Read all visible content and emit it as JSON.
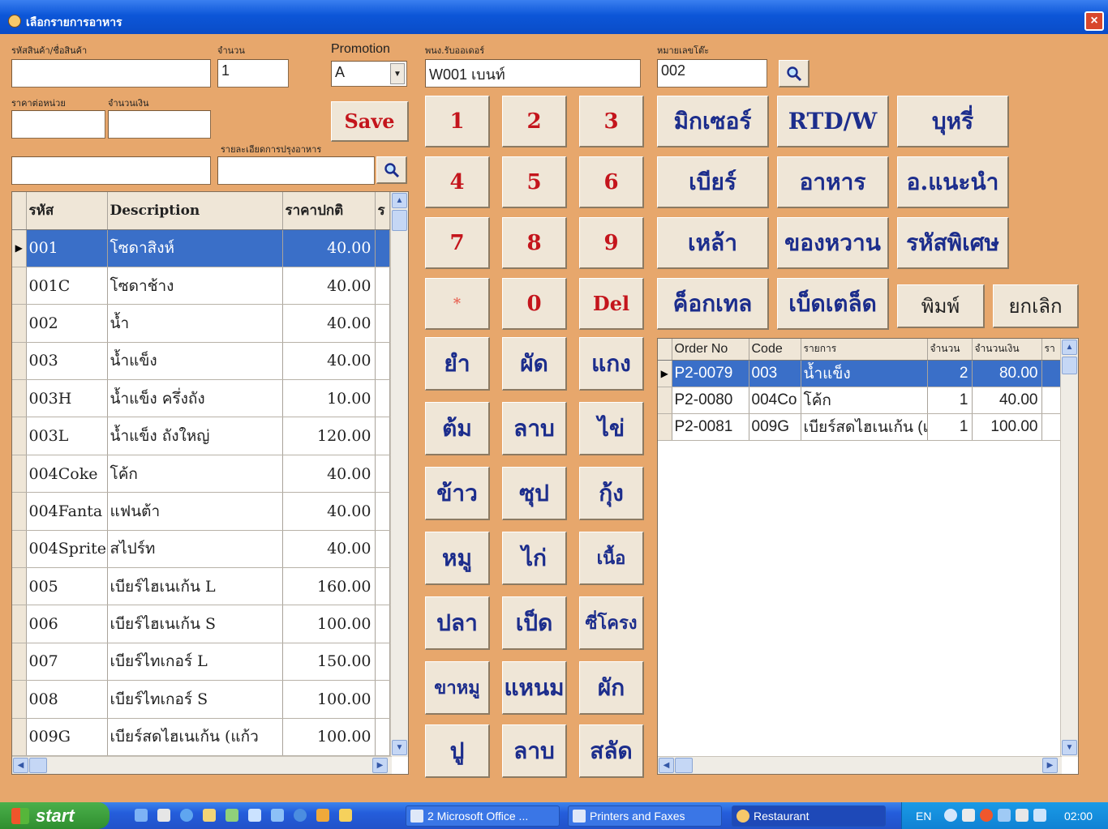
{
  "window": {
    "title": "เลือกรายการอาหาร",
    "close": "×"
  },
  "labels": {
    "product": "รหัสสินค้า/ชื่อสินค้า",
    "qty": "จำนวน",
    "promotion": "Promotion",
    "waiter": "พนง.รับออเดอร์",
    "table_no": "หมายเลขโต๊ะ",
    "unit_price": "ราคาต่อหน่วย",
    "amount": "จำนวนเงิน",
    "cooking_detail": "รายละเอียดการปรุงอาหาร"
  },
  "fields": {
    "product": "",
    "qty": "1",
    "promotion": "A",
    "waiter": "W001 เบนท์",
    "table_no": "002",
    "unit_price": "",
    "amount": "",
    "note": "",
    "cooking_detail": ""
  },
  "save_label": "Save",
  "keypad": [
    "1",
    "2",
    "3",
    "4",
    "5",
    "6",
    "7",
    "8",
    "9",
    "*",
    "0",
    "Del"
  ],
  "food_keys": [
    "ยำ",
    "ผัด",
    "แกง",
    "ต้ม",
    "ลาบ",
    "ไข่",
    "ข้าว",
    "ซุป",
    "กุ้ง",
    "หมู",
    "ไก่",
    "เนื้อ",
    "ปลา",
    "เป็ด",
    "ซี่โครง",
    "ขาหมู",
    "แหนม",
    "ผัก",
    "ปู",
    "ลาบ",
    "สลัด"
  ],
  "categories": [
    "มิกเซอร์",
    "RTD/W",
    "บุหรี่",
    "เบียร์",
    "อาหาร",
    "อ.แนะนำ",
    "เหล้า",
    "ของหวาน",
    "รหัสพิเศษ",
    "ค็อกเทล",
    "เบ็ดเตล็ด"
  ],
  "print_label": "พิมพ์",
  "cancel_label": "ยกเลิก",
  "products": {
    "headers": [
      "รหัส",
      "Description",
      "ราคาปกติ",
      "ร"
    ],
    "rows": [
      {
        "code": "001",
        "desc": "โซดาสิงห์",
        "price": "40.00"
      },
      {
        "code": "001C",
        "desc": "โซดาช้าง",
        "price": "40.00"
      },
      {
        "code": "002",
        "desc": "น้ำ",
        "price": "40.00"
      },
      {
        "code": "003",
        "desc": "น้ำแข็ง",
        "price": "40.00"
      },
      {
        "code": "003H",
        "desc": "น้ำแข็ง ครึ่งถัง",
        "price": "10.00"
      },
      {
        "code": "003L",
        "desc": "น้ำแข็ง ถังใหญ่",
        "price": "120.00"
      },
      {
        "code": "004Coke",
        "desc": "โค้ก",
        "price": "40.00"
      },
      {
        "code": "004Fanta",
        "desc": "แฟนต้า",
        "price": "40.00"
      },
      {
        "code": "004Sprite",
        "desc": "สไปร์ท",
        "price": "40.00"
      },
      {
        "code": "005",
        "desc": "เบียร์ไฮเนเก้น L",
        "price": "160.00"
      },
      {
        "code": "006",
        "desc": "เบียร์ไฮเนเก้น S",
        "price": "100.00"
      },
      {
        "code": "007",
        "desc": "เบียร์ไทเกอร์ L",
        "price": "150.00"
      },
      {
        "code": "008",
        "desc": "เบียร์ไทเกอร์ S",
        "price": "100.00"
      },
      {
        "code": "009G",
        "desc": "เบียร์สดไฮเนเก้น (แก้ว",
        "price": "100.00"
      }
    ]
  },
  "orders": {
    "headers": [
      "Order No",
      "Code",
      "รายการ",
      "จำนวน",
      "จำนวนเงิน",
      "รา"
    ],
    "rows": [
      {
        "order": "P2-0079",
        "code": "003",
        "item": "น้ำแข็ง",
        "qty": "2",
        "amount": "80.00"
      },
      {
        "order": "P2-0080",
        "code": "004Co",
        "item": "โค้ก",
        "qty": "1",
        "amount": "40.00"
      },
      {
        "order": "P2-0081",
        "code": "009G",
        "item": "เบียร์สดไฮเนเก้น (แ",
        "qty": "1",
        "amount": "100.00"
      }
    ]
  },
  "taskbar": {
    "start": "start",
    "items": [
      "2 Microsoft Office ...",
      "Printers and Faxes",
      "Restaurant"
    ],
    "lang": "EN",
    "time": "02:00"
  },
  "icons": {
    "search": "search-icon",
    "close": "close-icon",
    "arrow": "row-pointer-icon"
  }
}
